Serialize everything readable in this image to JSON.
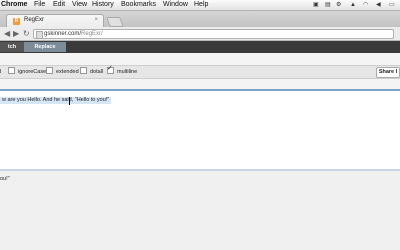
{
  "menubar": {
    "app": "Chrome",
    "items": [
      "File",
      "Edit",
      "View",
      "History",
      "Bookmarks",
      "Window",
      "Help"
    ]
  },
  "tab": {
    "title": "RegExr",
    "favicon": "R"
  },
  "address": {
    "scheme": "gskinner.com/",
    "path": "RegExr/"
  },
  "app": {
    "modes": [
      "tch",
      "Replace"
    ],
    "options": [
      {
        "label": "ignoreCase",
        "checked": false
      },
      {
        "label": "extended",
        "checked": false
      },
      {
        "label": "dotall",
        "checked": false
      },
      {
        "label": "multiline",
        "checked": true
      }
    ],
    "share_label": "Share I",
    "source_text": "w are you Hello. And he said, \"Hello to you!\"",
    "result_text": "ou!\""
  },
  "colors": {
    "accent": "#7aa3c9",
    "topbar": "#3a3a3a",
    "favicon": "#f19a3b"
  }
}
